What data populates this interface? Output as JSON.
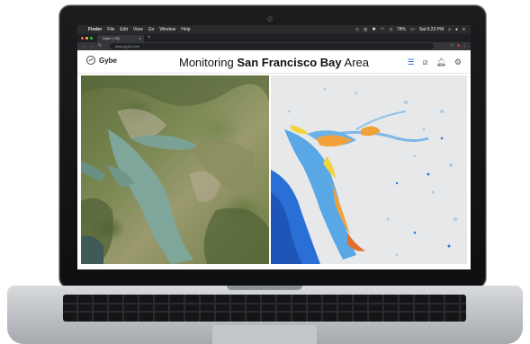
{
  "menubar": {
    "apple": "",
    "items": [
      "Finder",
      "File",
      "Edit",
      "View",
      "Go",
      "Window",
      "Help"
    ],
    "battery": "78%",
    "clock": "Sat 6:23 PM"
  },
  "browser": {
    "tab_title": "Gybe | HQ",
    "tab_close": "×",
    "new_tab": "+",
    "url": "www.gybe.com"
  },
  "app": {
    "logo_text": "Gybe",
    "title_prefix": "Monitoring ",
    "title_bold": "San Francisco Bay",
    "title_suffix": " Area",
    "icons": [
      "sliders-icon",
      "layers-toggle-icon",
      "bell-icon",
      "gear-icon"
    ]
  },
  "colors": {
    "accent": "#2b73d6",
    "water_left": "#7fa69a",
    "water_right_deep": "#2a6fd6",
    "bloom_orange": "#f2a13a",
    "bloom_yellow": "#f2d43a"
  }
}
